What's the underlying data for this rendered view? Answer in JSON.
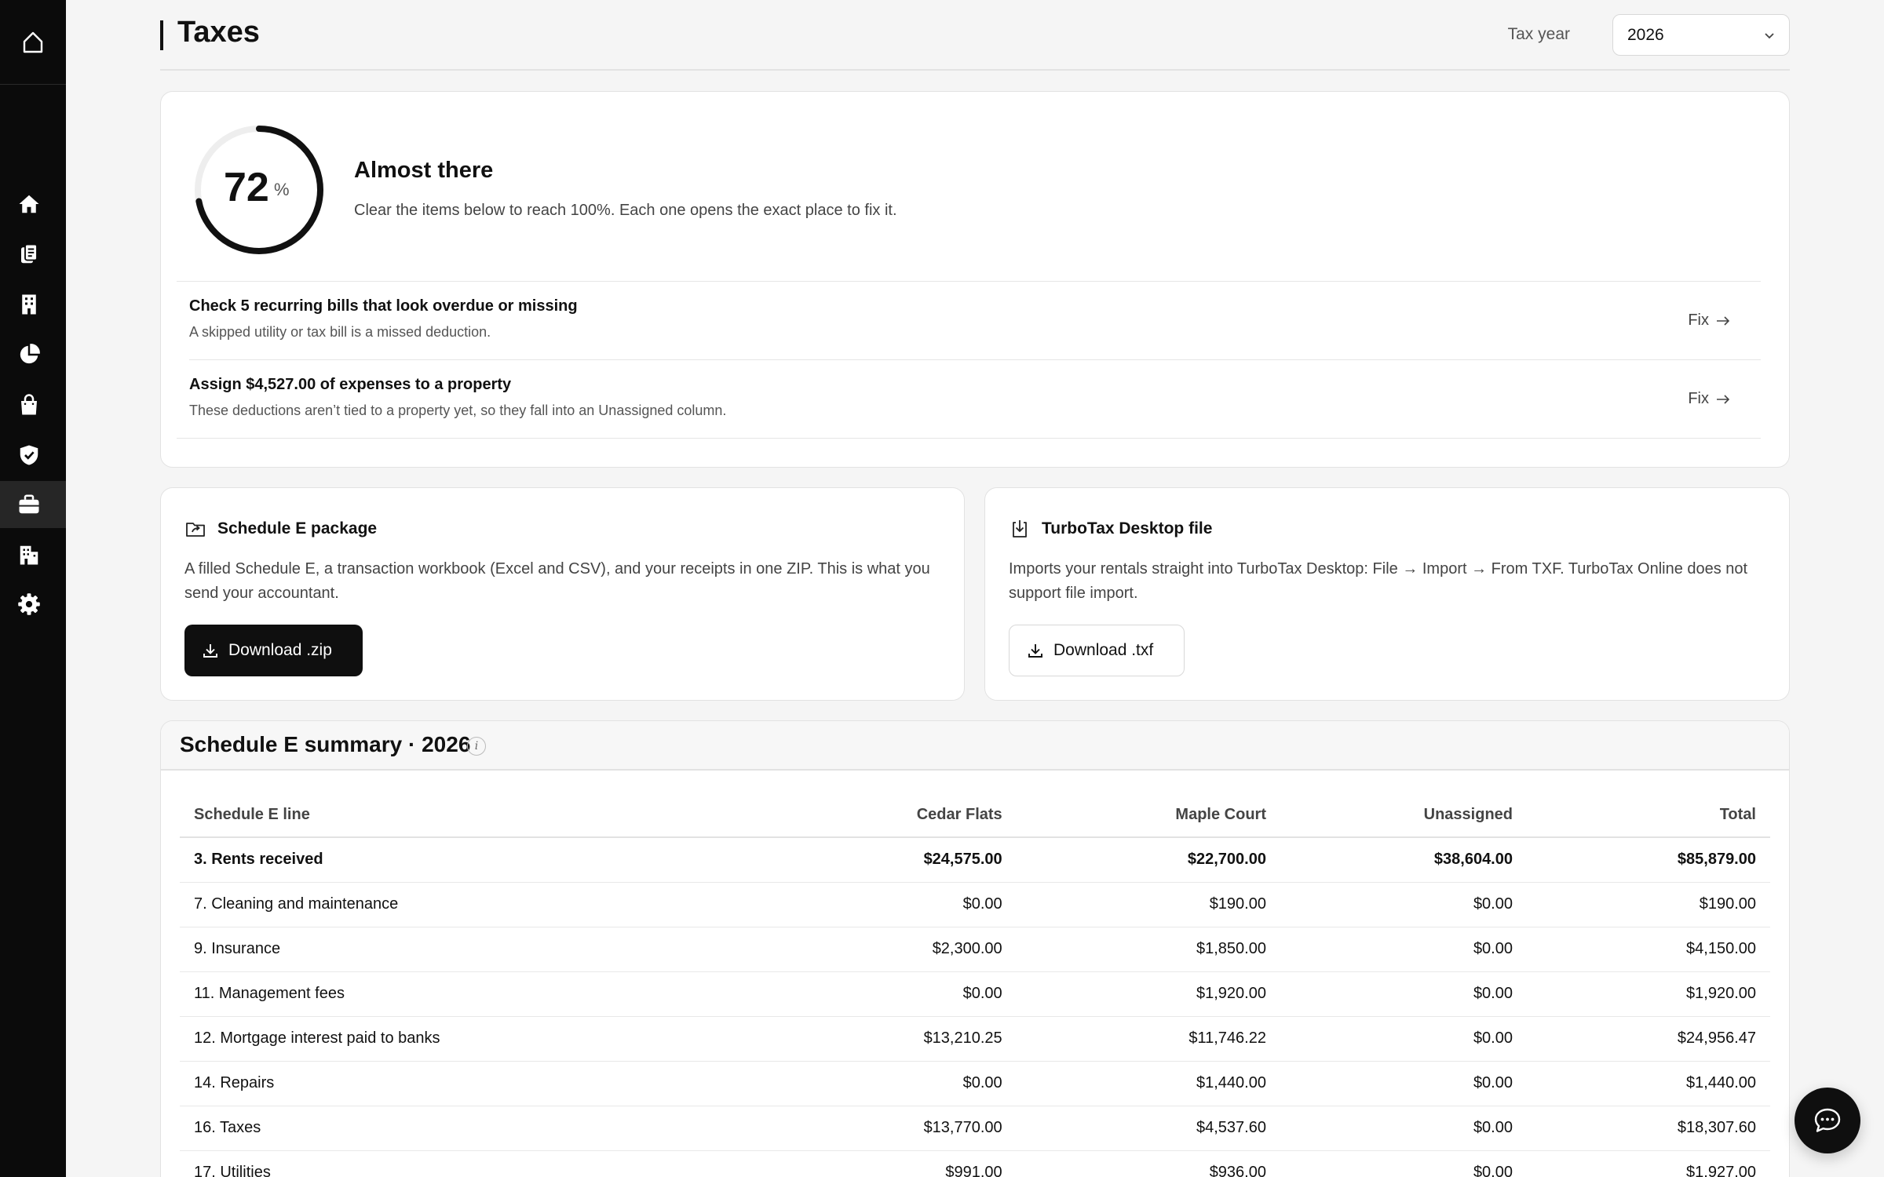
{
  "header": {
    "title": "Taxes",
    "tax_year_label": "Tax year",
    "tax_year_value": "2026"
  },
  "progress": {
    "value": "72",
    "unit": "%",
    "percent_complete": 72,
    "heading": "Almost there",
    "subtitle": "Clear the items below to reach 100%. Each one opens the exact place to fix it."
  },
  "todos": [
    {
      "title": "Check 5 recurring bills that look overdue or missing",
      "description": "A skipped utility or tax bill is a missed deduction.",
      "action": "Fix"
    },
    {
      "title": "Assign $4,527.00 of expenses to a property",
      "description": "These deductions aren’t tied to a property yet, so they fall into an Unassigned column.",
      "action": "Fix"
    }
  ],
  "schedule_e_package": {
    "title": "Schedule E package",
    "description": "A filled Schedule E, a transaction workbook (Excel and CSV), and your receipts in one ZIP. This is what you send your accountant.",
    "button": "Download .zip"
  },
  "turbotax": {
    "title": "TurboTax Desktop file",
    "description": "Imports your rentals straight into TurboTax Desktop: File → Import → From TXF. TurboTax Online does not support file import.",
    "button": "Download .txf"
  },
  "summary": {
    "title": "Schedule E summary · 2026",
    "info": "i",
    "columns": [
      "Schedule E line",
      "Cedar Flats",
      "Maple Court",
      "Unassigned",
      "Total"
    ],
    "rows": [
      [
        "3. Rents received",
        "$24,575.00",
        "$22,700.00",
        "$38,604.00",
        "$85,879.00"
      ],
      [
        "7. Cleaning and maintenance",
        "$0.00",
        "$190.00",
        "$0.00",
        "$190.00"
      ],
      [
        "9. Insurance",
        "$2,300.00",
        "$1,850.00",
        "$0.00",
        "$4,150.00"
      ],
      [
        "11. Management fees",
        "$0.00",
        "$1,920.00",
        "$0.00",
        "$1,920.00"
      ],
      [
        "12. Mortgage interest paid to banks",
        "$13,210.25",
        "$11,746.22",
        "$0.00",
        "$24,956.47"
      ],
      [
        "14. Repairs",
        "$0.00",
        "$1,440.00",
        "$0.00",
        "$1,440.00"
      ],
      [
        "16. Taxes",
        "$13,770.00",
        "$4,537.60",
        "$0.00",
        "$18,307.60"
      ],
      [
        "17. Utilities",
        "$991.00",
        "$936.00",
        "$0.00",
        "$1,927.00"
      ]
    ]
  },
  "sidebar": {
    "items": [
      {
        "icon": "home-icon"
      },
      {
        "icon": "documents-icon"
      },
      {
        "icon": "building-icon"
      },
      {
        "icon": "pie-chart-icon"
      },
      {
        "icon": "shopping-bag-icon"
      },
      {
        "icon": "shield-check-icon"
      },
      {
        "icon": "briefcase-icon",
        "active": true
      },
      {
        "icon": "buildings-icon"
      },
      {
        "icon": "gear-icon"
      }
    ]
  },
  "colors": {
    "sidebar_bg": "#0b0b0b",
    "primary_button": "#0f0f0f",
    "page_bg": "#f5f5f5"
  }
}
